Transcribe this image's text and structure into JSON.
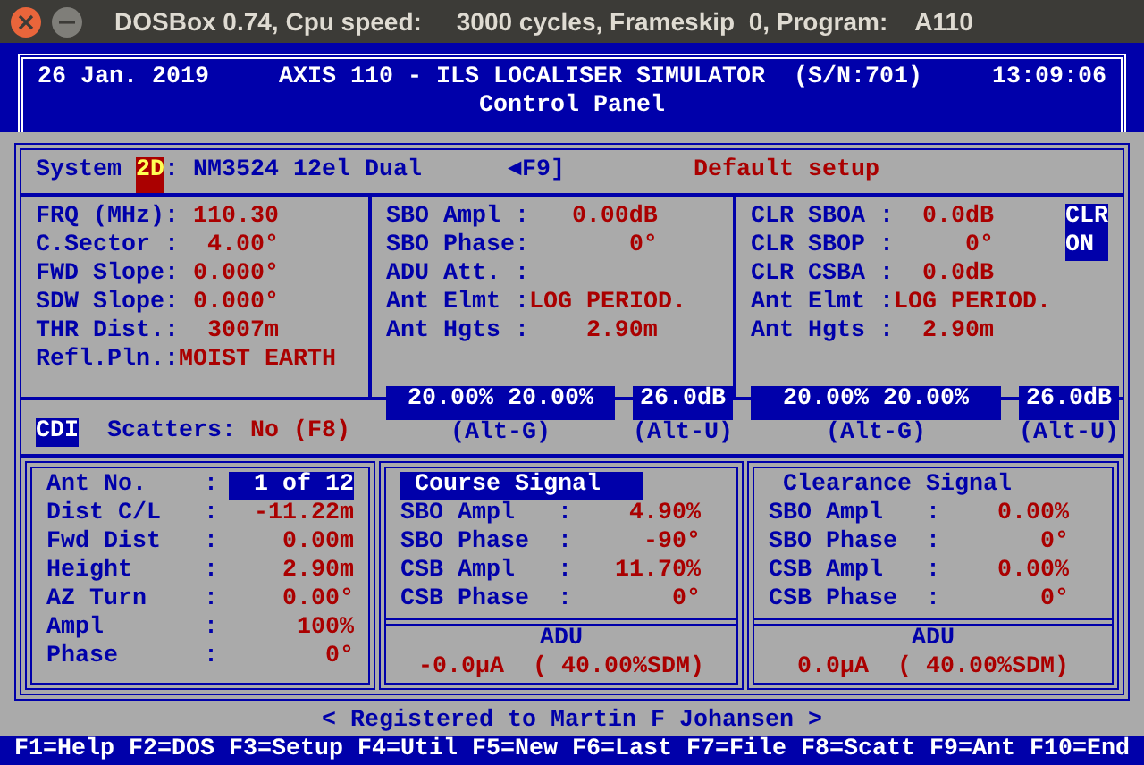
{
  "window": {
    "title": "DOSBox 0.74, Cpu speed:     3000 cycles, Frameskip  0, Program:    A110"
  },
  "header": {
    "date": "26 Jan. 2019",
    "title": "AXIS 110 - ILS LOCALISER SIMULATOR  (S/N:701)",
    "time": "13:09:06",
    "subtitle": "Control Panel"
  },
  "system": {
    "label": "System",
    "mode": "2D",
    "name": ": NM3524 12el Dual",
    "key": "◄F9]",
    "setup": "Default setup"
  },
  "transmitter": [
    {
      "label": "FRQ (MHz):",
      "value": "110.30"
    },
    {
      "label": "C.Sector :",
      "value": "4.00°"
    },
    {
      "label": "FWD Slope:",
      "value": "0.000°"
    },
    {
      "label": "SDW Slope:",
      "value": "0.000°"
    },
    {
      "label": "THR Dist.:",
      "value": "3007m"
    },
    {
      "label": "Refl.Pln.:",
      "value": "MOIST EARTH"
    }
  ],
  "course_params": [
    {
      "label": "SBO Ampl :",
      "value": "0.00dB"
    },
    {
      "label": "SBO Phase:",
      "value": "0°"
    },
    {
      "label": "ADU Att. :"
    },
    {
      "label": "Ant Elmt :",
      "value": "LOG PERIOD."
    },
    {
      "label": "Ant Hgts :",
      "value": "2.90m"
    }
  ],
  "clearance_params": [
    {
      "label": "CLR SBOA :",
      "value": "0.0dB"
    },
    {
      "label": "CLR SBOP :",
      "value": "0°"
    },
    {
      "label": "CLR CSBA :",
      "value": "0.0dB"
    },
    {
      "label": "Ant Elmt :",
      "value": "LOG PERIOD."
    },
    {
      "label": "Ant Hgts :",
      "value": "2.90m"
    }
  ],
  "clr_indicator": [
    "CLR",
    "ON"
  ],
  "course_levels": {
    "gain": "20.00% 20.00%",
    "attenuation": "26.0dB",
    "gain_key": "(Alt-G)",
    "attenuation_key": "(Alt-U)"
  },
  "clearance_levels": {
    "gain": "20.00% 20.00%",
    "attenuation": "26.0dB",
    "gain_key": "(Alt-G)",
    "attenuation_key": "(Alt-U)"
  },
  "cdi": {
    "label": "CDI",
    "on": true
  },
  "scatters": {
    "label": "Scatters:",
    "value": "No (F8)"
  },
  "antenna": [
    {
      "label": "Ant No.    :",
      "value": "1 of 12",
      "selected": true
    },
    {
      "label": "Dist C/L   :",
      "value": "-11.22m",
      "selected": false
    },
    {
      "label": "Fwd Dist   :",
      "value": "0.00m",
      "selected": false
    },
    {
      "label": "Height     :",
      "value": "2.90m",
      "selected": false
    },
    {
      "label": "AZ Turn    :",
      "value": "0.00°",
      "selected": false
    },
    {
      "label": "Ampl       :",
      "value": "100%",
      "selected": false
    },
    {
      "label": "Phase      :",
      "value": "0°",
      "selected": false
    }
  ],
  "signals": [
    {
      "title": "Course Signal",
      "selected": true,
      "rows": [
        {
          "label": "SBO Ampl   :",
          "value": "4.90%"
        },
        {
          "label": "SBO Phase  :",
          "value": "-90°"
        },
        {
          "label": "CSB Ampl   :",
          "value": "11.70%"
        },
        {
          "label": "CSB Phase  :",
          "value": "0°"
        }
      ],
      "adu_title": "ADU",
      "adu": "-0.0µA  ( 40.00%SDM)"
    },
    {
      "title": "Clearance Signal",
      "selected": false,
      "rows": [
        {
          "label": "SBO Ampl   :",
          "value": "0.00%"
        },
        {
          "label": "SBO Phase  :",
          "value": "0°"
        },
        {
          "label": "CSB Ampl   :",
          "value": "0.00%"
        },
        {
          "label": "CSB Phase  :",
          "value": "0°"
        }
      ],
      "adu_title": "ADU",
      "adu": "0.0µA  ( 40.00%SDM)"
    }
  ],
  "registration": "< Registered to Martin F Johansen >",
  "function_keys": [
    "F1=Help",
    "F2=DOS",
    "F3=Setup",
    "F4=Util",
    "F5=New",
    "F6=Last",
    "F7=File",
    "F8=Scatt",
    "F9=Ant",
    "F10=End"
  ]
}
